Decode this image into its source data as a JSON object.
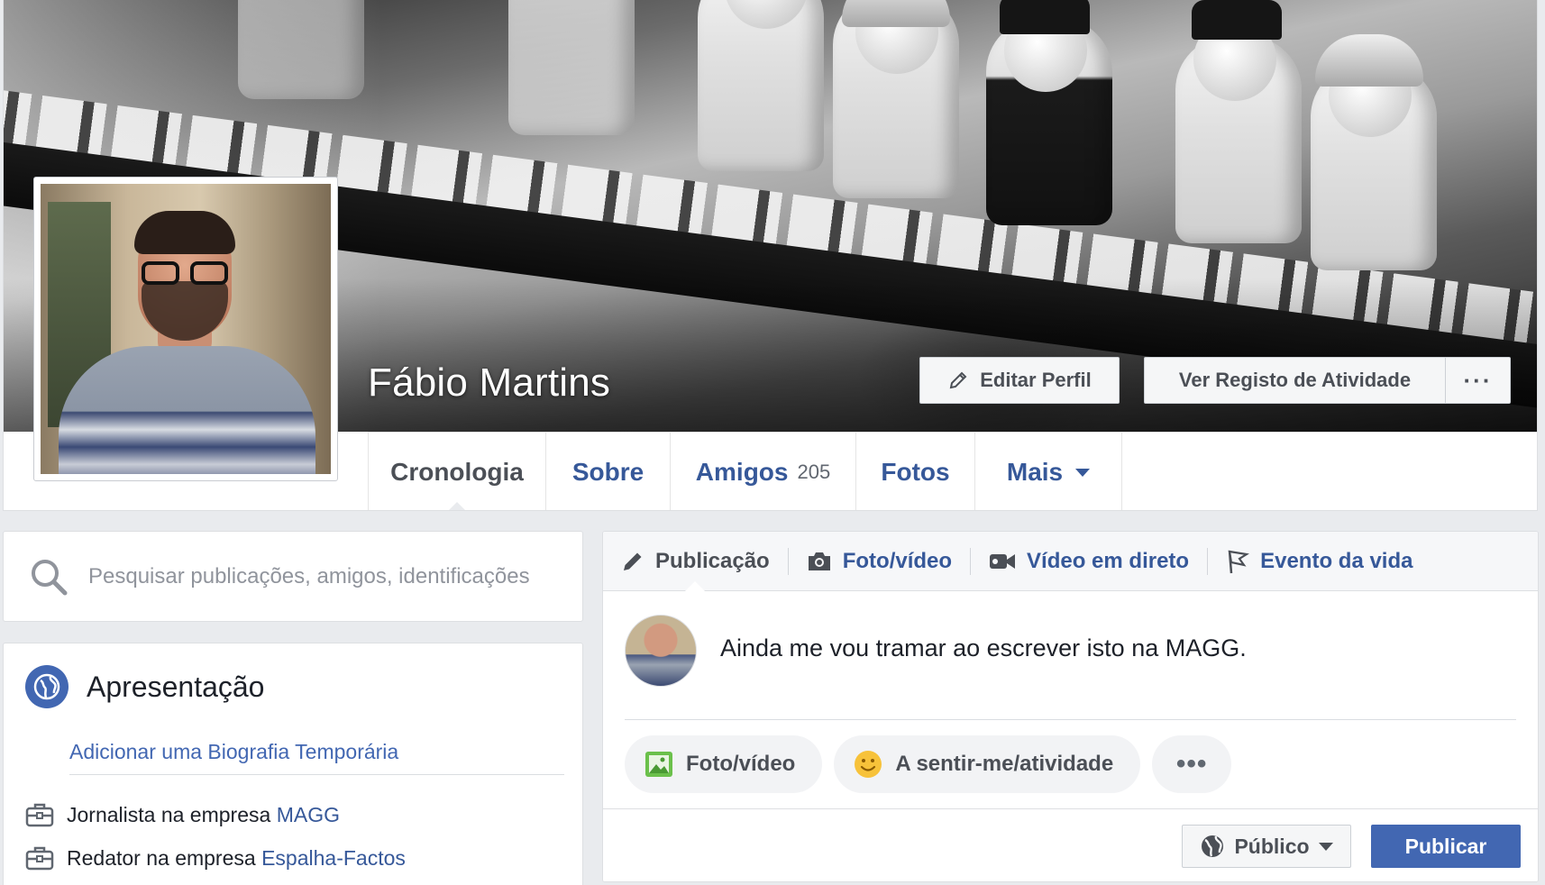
{
  "profile": {
    "name": "Fábio Martins"
  },
  "cover_actions": {
    "edit_profile": "Editar Perfil",
    "activity_log": "Ver Registo de Atividade",
    "more": "···"
  },
  "tabs": [
    {
      "label": "Cronologia",
      "active": true
    },
    {
      "label": "Sobre"
    },
    {
      "label": "Amigos",
      "count": "205"
    },
    {
      "label": "Fotos"
    },
    {
      "label": "Mais"
    }
  ],
  "search": {
    "placeholder": "Pesquisar publicações, amigos, identificações"
  },
  "intro": {
    "title": "Apresentação",
    "bio_link": "Adicionar uma Biografia Temporária",
    "jobs": [
      {
        "prefix": "Jornalista na empresa ",
        "company": "MAGG"
      },
      {
        "prefix": "Redator na empresa ",
        "company": "Espalha-Factos"
      }
    ]
  },
  "composer": {
    "tabs": [
      {
        "label": "Publicação",
        "icon": "pencil-icon"
      },
      {
        "label": "Foto/vídeo",
        "icon": "camera-icon"
      },
      {
        "label": "Vídeo em direto",
        "icon": "video-camera-icon"
      },
      {
        "label": "Evento da vida",
        "icon": "flag-icon"
      }
    ],
    "text": "Ainda me vou tramar ao escrever isto na MAGG.",
    "chips": [
      {
        "label": "Foto/vídeo",
        "icon": "photo-icon"
      },
      {
        "label": "A sentir-me/atividade",
        "icon": "smiley-icon"
      },
      {
        "label": "•••"
      }
    ],
    "audience": "Público",
    "publish": "Publicar"
  },
  "colors": {
    "brand_blue": "#4267b2",
    "link_blue": "#365899",
    "page_bg": "#e9ebee"
  }
}
